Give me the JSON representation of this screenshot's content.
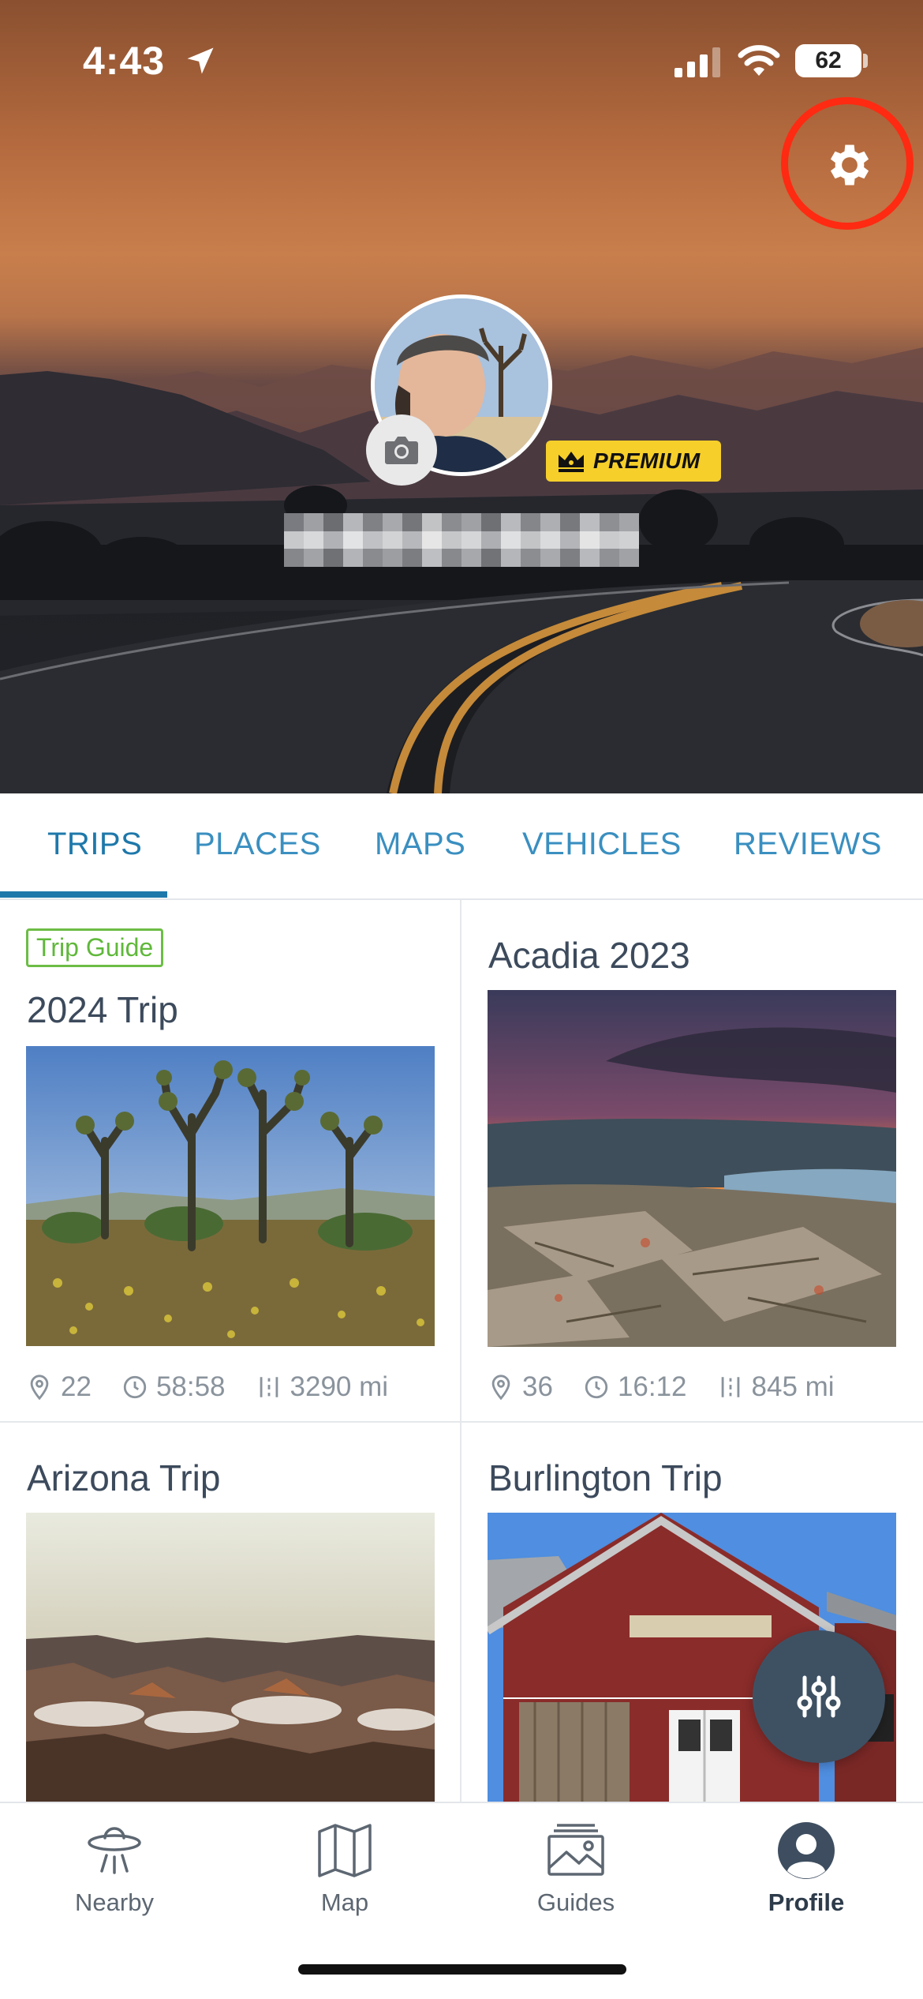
{
  "status_bar": {
    "time": "4:43",
    "battery": "62"
  },
  "profile": {
    "badge_label": "PREMIUM"
  },
  "tabs": [
    {
      "label": "TRIPS",
      "active": true
    },
    {
      "label": "PLACES",
      "active": false
    },
    {
      "label": "MAPS",
      "active": false
    },
    {
      "label": "VEHICLES",
      "active": false
    },
    {
      "label": "REVIEWS",
      "active": false
    }
  ],
  "trips": [
    {
      "tag": "Trip Guide",
      "title": "2024 Trip",
      "stops": "22",
      "duration": "58:58",
      "distance": "3290 mi"
    },
    {
      "title": "Acadia 2023",
      "stops": "36",
      "duration": "16:12",
      "distance": "845 mi"
    },
    {
      "title": "Arizona Trip"
    },
    {
      "title": "Burlington Trip"
    }
  ],
  "bottom_nav": [
    {
      "label": "Nearby",
      "icon": "ufo-icon"
    },
    {
      "label": "Map",
      "icon": "map-icon"
    },
    {
      "label": "Guides",
      "icon": "guides-icon"
    },
    {
      "label": "Profile",
      "icon": "profile-icon",
      "active": true
    }
  ],
  "colors": {
    "accent": "#1e78aa",
    "premium": "#f6cf2a",
    "settings_highlight": "#ff2a12",
    "trip_guide_tag": "#5fb83a"
  }
}
